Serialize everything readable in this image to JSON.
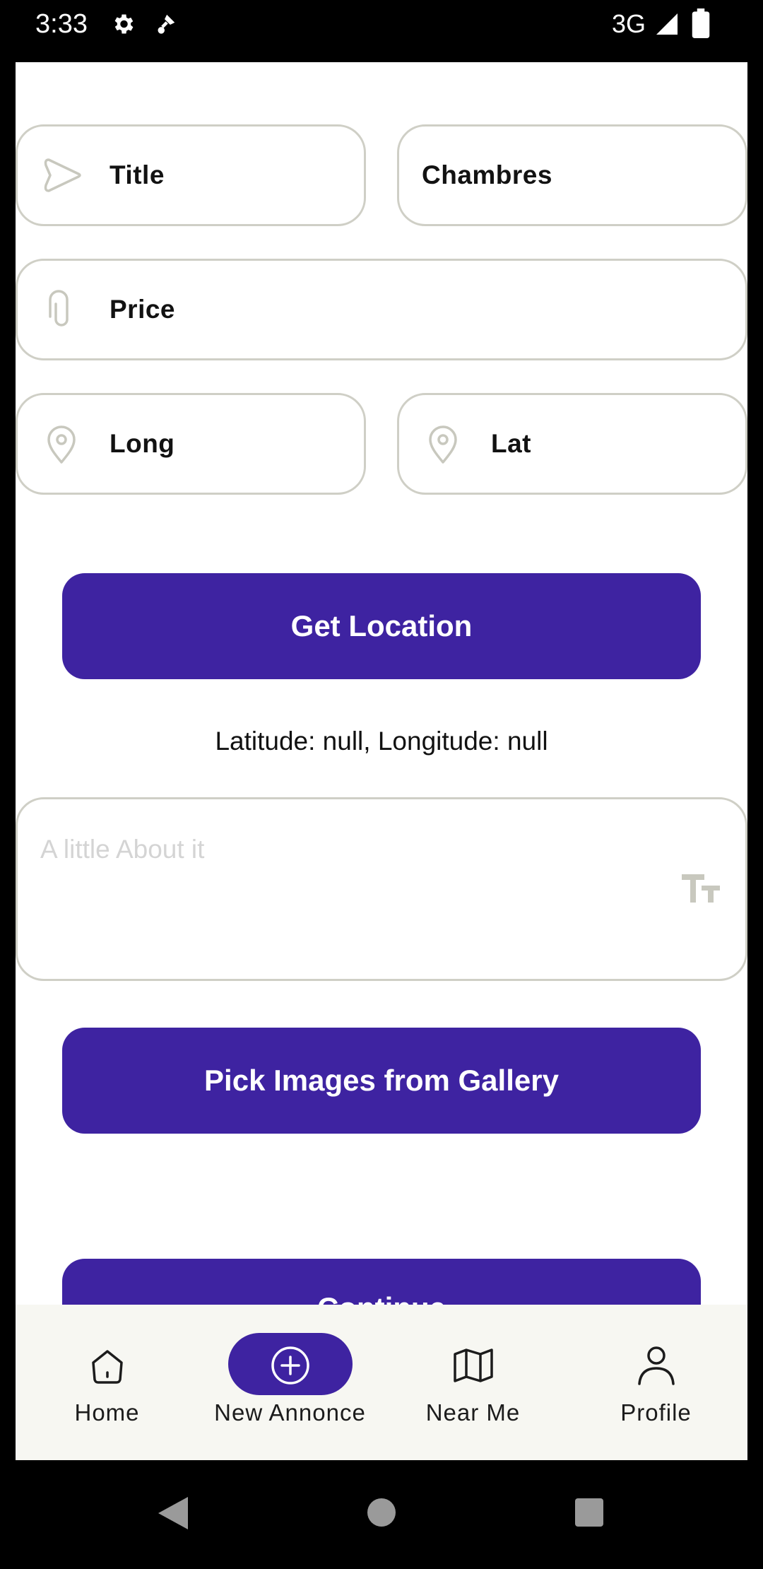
{
  "status_bar": {
    "time": "3:33",
    "network": "3G",
    "icons": [
      "settings-gear-icon",
      "satellite-icon",
      "signal-icon",
      "battery-icon"
    ]
  },
  "form": {
    "title_label": "Title",
    "chambres_label": "Chambres",
    "price_label": "Price",
    "long_label": "Long",
    "lat_label": "Lat",
    "about_placeholder": "A little About it",
    "location_text": "Latitude: null, Longitude: null"
  },
  "buttons": {
    "get_location": "Get Location",
    "pick_images": "Pick Images from Gallery",
    "partial_button_label": "Continue"
  },
  "bottom_nav": {
    "items": [
      {
        "label": "Home",
        "icon": "home-icon",
        "selected": false
      },
      {
        "label": "New Annonce",
        "icon": "add-circle-icon",
        "selected": true
      },
      {
        "label": "Near Me",
        "icon": "map-icon",
        "selected": false
      },
      {
        "label": "Profile",
        "icon": "person-icon",
        "selected": false
      }
    ]
  },
  "colors": {
    "accent": "#3e23a1",
    "field_border": "#cfcfc6",
    "nav_background": "#f7f7f2"
  }
}
